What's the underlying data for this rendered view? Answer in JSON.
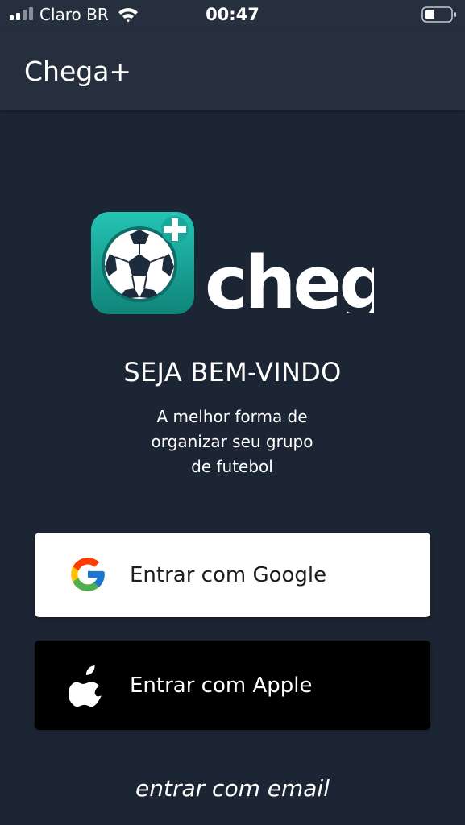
{
  "status_bar": {
    "carrier": "Claro BR",
    "time": "00:47",
    "icons": [
      "signal-icon",
      "wifi-icon",
      "battery-icon"
    ]
  },
  "header": {
    "title": "Chega+"
  },
  "logo": {
    "wordmark": "chega+",
    "icon": "soccer-ball-plus-icon"
  },
  "welcome": {
    "title": "SEJA BEM-VINDO",
    "line1": "A melhor forma de",
    "line2": "organizar seu grupo",
    "line3": "de futebol"
  },
  "buttons": {
    "google_label": "Entrar com Google",
    "apple_label": "Entrar com Apple"
  },
  "email_link": "entrar com email",
  "colors": {
    "background": "#1c2533",
    "header": "#252f3d",
    "logo_teal": "#1aa89a",
    "google_button": "#ffffff",
    "apple_button": "#000000"
  }
}
